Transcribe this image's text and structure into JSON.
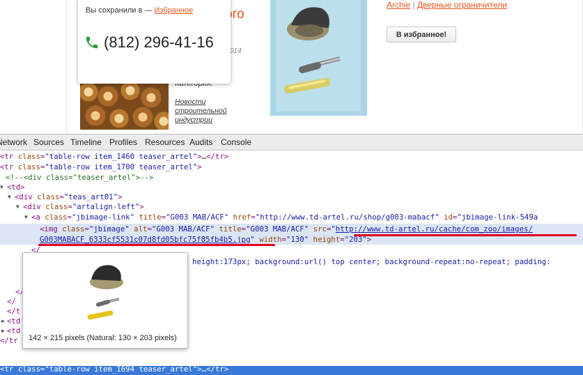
{
  "page": {
    "heading_partial": "ого",
    "date_partial": "014",
    "category_label": "Категория:",
    "news_link": "Новости строительной индустрии",
    "popup": {
      "saved_prefix": "Вы сохранили в — ",
      "saved_link": "Избранное",
      "phone": "(812) 296-41-16"
    },
    "breadcrumb": {
      "brand": "Archie",
      "separator": " | ",
      "category": "Дверные ограничители"
    },
    "favorite_button": "В избранное!"
  },
  "devtools": {
    "tabs": [
      "Network",
      "Sources",
      "Timeline",
      "Profiles",
      "Resources",
      "Audits",
      "Console"
    ],
    "tooltip_dimensions": "142 × 215 pixels (Natural: 130 × 203 pixels)"
  },
  "colors": {
    "accent": "#e8541c",
    "selection_background": "#dbe5f3",
    "status_bar": "#3879d9",
    "underline_red": "#e0001f"
  }
}
